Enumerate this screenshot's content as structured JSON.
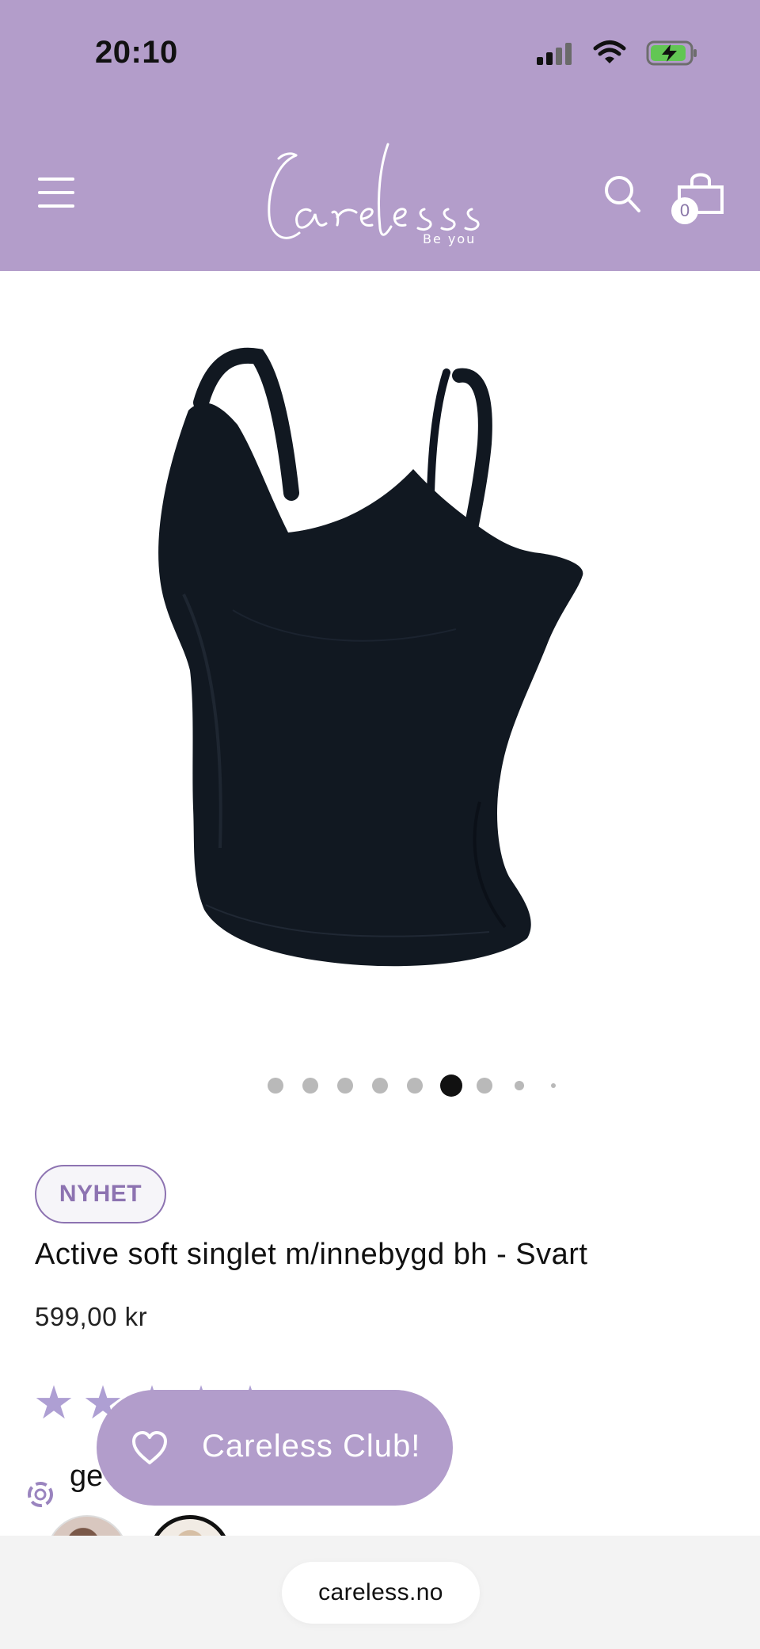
{
  "status_bar": {
    "time": "20:10"
  },
  "header": {
    "brand": "Careless",
    "tagline": "Be you",
    "cart_count": "0",
    "background_color": "#b39dca"
  },
  "product": {
    "badge": "NYHET",
    "title": "Active soft singlet m/innebygd bh - Svart",
    "price": "599,00 kr",
    "rating_stars": 5,
    "image_alt": "Black active soft singlet with built-in bra"
  },
  "carousel": {
    "active_index": 5,
    "dot_count": 9
  },
  "overlay": {
    "partial_text": "ge",
    "club_button_label": "Careless Club!"
  },
  "browser": {
    "url": "careless.no"
  },
  "icons": {
    "menu": "menu-icon",
    "search": "search-icon",
    "cart": "shopping-bag-icon",
    "heart": "heart-icon",
    "reward": "reward-icon"
  }
}
